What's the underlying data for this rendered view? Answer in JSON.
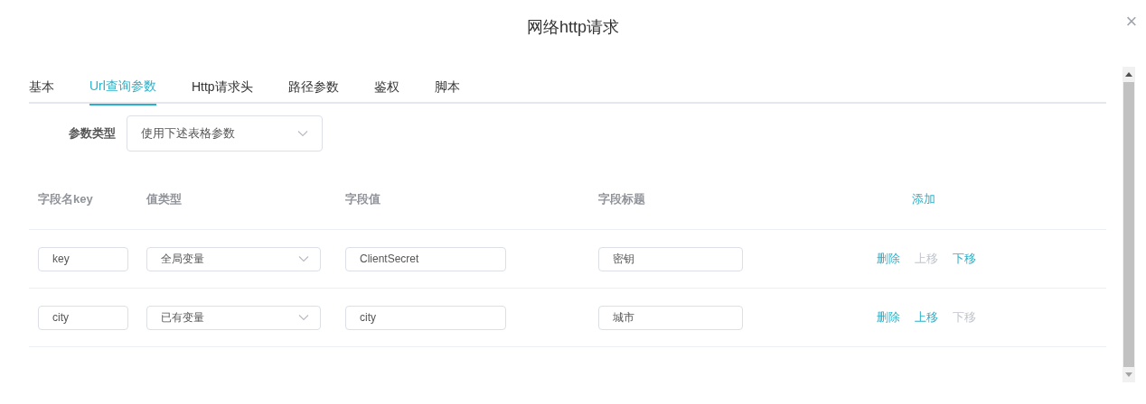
{
  "dialog": {
    "title": "网络http请求",
    "close": "×"
  },
  "tabs": [
    {
      "label": "基本",
      "selected": false
    },
    {
      "label": "Url查询参数",
      "selected": true
    },
    {
      "label": "Http请求头",
      "selected": false
    },
    {
      "label": "路径参数",
      "selected": false
    },
    {
      "label": "鉴权",
      "selected": false
    },
    {
      "label": "脚本",
      "selected": false
    }
  ],
  "param_type": {
    "label": "参数类型",
    "value": "使用下述表格参数"
  },
  "table": {
    "columns": [
      "字段名key",
      "值类型",
      "字段值",
      "字段标题"
    ],
    "add_link": "添加",
    "rows": [
      {
        "key": "key",
        "value_type": "全局变量",
        "value": "ClientSecret",
        "title": "密钥",
        "actions": [
          {
            "label": "删除",
            "disabled": false
          },
          {
            "label": "上移",
            "disabled": true
          },
          {
            "label": "下移",
            "disabled": false
          }
        ]
      },
      {
        "key": "city",
        "value_type": "已有变量",
        "value": "city",
        "title": "城市",
        "actions": [
          {
            "label": "删除",
            "disabled": false
          },
          {
            "label": "上移",
            "disabled": false
          },
          {
            "label": "下移",
            "disabled": true
          }
        ]
      }
    ]
  }
}
